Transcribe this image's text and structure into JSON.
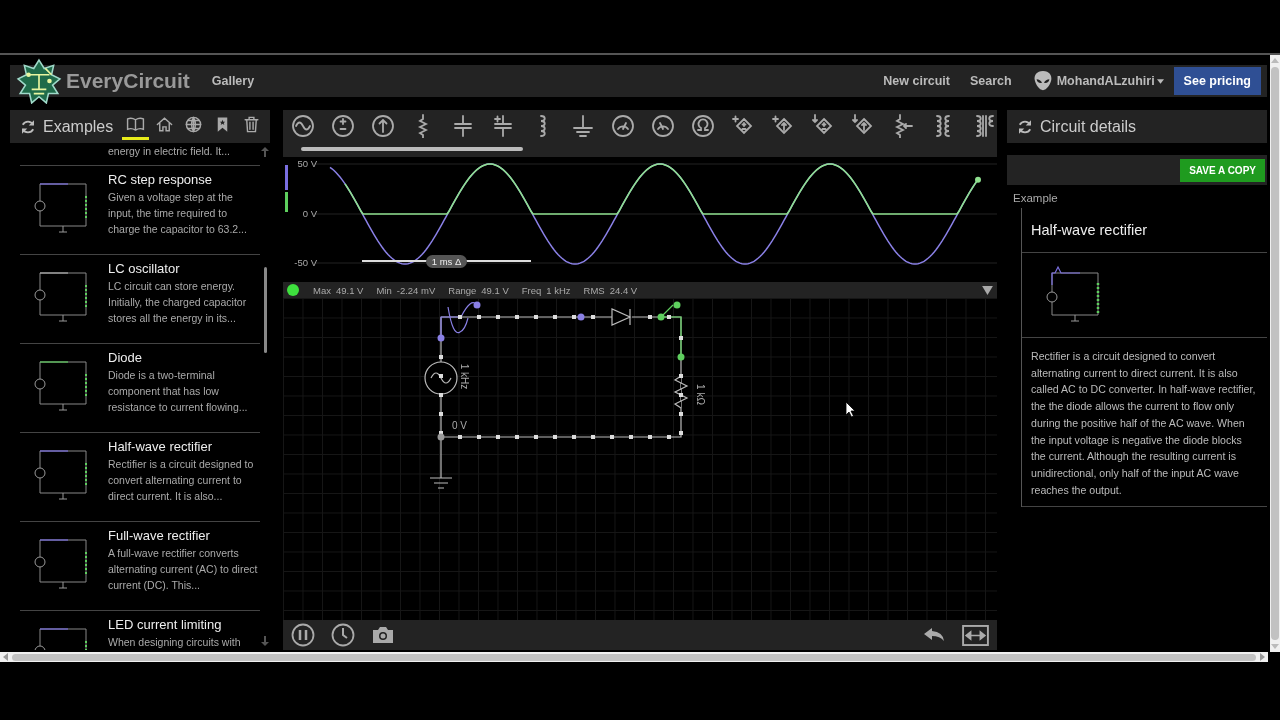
{
  "header": {
    "logo": "EveryCircuit",
    "nav": [
      {
        "label": "Gallery"
      }
    ],
    "actions": [
      {
        "label": "New circuit"
      },
      {
        "label": "Search"
      }
    ],
    "user": "MohandALzuhiri",
    "pricing_button": "See pricing"
  },
  "examples_panel": {
    "title": "Examples",
    "tabs": [
      {
        "selected": true
      },
      {
        "selected": false
      },
      {
        "selected": false
      },
      {
        "selected": false
      },
      {
        "selected": false
      }
    ],
    "items": [
      {
        "description": "energy in electric field. It..."
      },
      {
        "title": "RC step response",
        "description": "Given a voltage step at the input, the time required to charge the capacitor to 63.2..."
      },
      {
        "title": "LC oscillator",
        "description": "LC circuit can store energy. Initially, the charged capacitor stores all the energy in its..."
      },
      {
        "title": "Diode",
        "description": "Diode is a two-terminal component that has low resistance to current flowing..."
      },
      {
        "title": "Half-wave rectifier",
        "description": "Rectifier is a circuit designed to convert alternating current to direct current. It is also..."
      },
      {
        "title": "Full-wave rectifier",
        "description": "A full-wave rectifier converts alternating current (AC) to direct current (DC). This..."
      },
      {
        "title": "LED current limiting",
        "description": "When designing circuits with"
      }
    ]
  },
  "scope": {
    "y_labels": [
      "50 V",
      "0 V",
      "-50 V"
    ],
    "time_scale": "1 ms Δ",
    "stats": [
      {
        "label": "Max",
        "value": "49.1 V"
      },
      {
        "label": "Min",
        "value": "-2.24 mV"
      },
      {
        "label": "Range",
        "value": "49.1 V"
      },
      {
        "label": "Freq",
        "value": "1 kHz"
      },
      {
        "label": "RMS",
        "value": "24.4 V"
      }
    ]
  },
  "circuit": {
    "source_label": "1 kHz",
    "resistor_label": "1 kΩ",
    "node_label": "0 V"
  },
  "details_panel": {
    "title": "Circuit details",
    "save_button": "SAVE A COPY",
    "section_label": "Example",
    "circuit_title": "Half-wave rectifier",
    "description": "Rectifier is a circuit designed to convert alternating current to direct current. It is also called AC to DC converter. In half-wave rectifier, the the diode allows the current to flow only during the positive half of the AC wave. When the input voltage is negative the diode blocks the current. Although the resulting current is unidirectional, only half of the input AC wave reaches the output."
  }
}
